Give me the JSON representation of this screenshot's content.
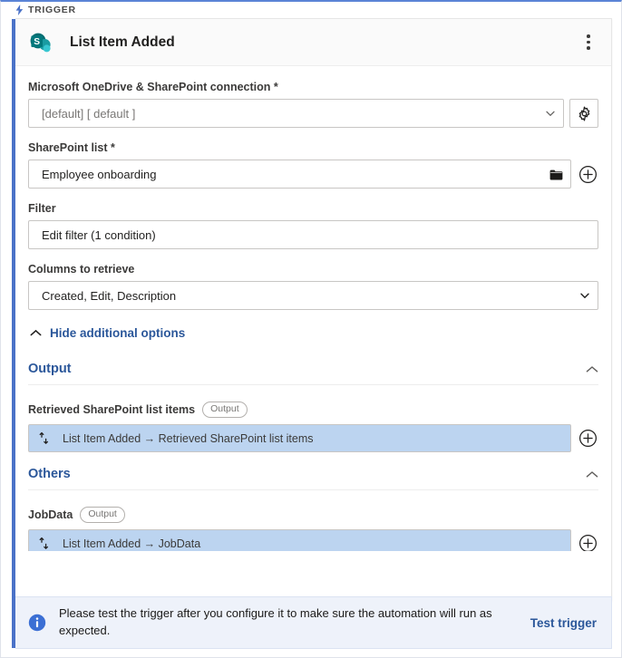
{
  "trigger_strip": {
    "label": "TRIGGER",
    "icon": "bolt-icon"
  },
  "card": {
    "title": "List Item Added",
    "app_icon": "sharepoint-icon",
    "menu_icon": "kebab-menu-icon"
  },
  "fields": {
    "connection": {
      "label": "Microsoft OneDrive & SharePoint connection *",
      "value": "[default] [ default ]",
      "dropdown_icon": "chevron-down-icon",
      "settings_icon": "gear-icon"
    },
    "sharepoint_list": {
      "label": "SharePoint list *",
      "value": "Employee onboarding",
      "browse_icon": "folder-icon",
      "add_icon": "plus-circle-icon"
    },
    "filter": {
      "label": "Filter",
      "value": "Edit filter (1 condition)"
    },
    "columns": {
      "label": "Columns to retrieve",
      "value": "Created, Edit, Description",
      "dropdown_icon": "chevron-down-icon"
    }
  },
  "additional_options": {
    "label": "Hide additional options",
    "icon": "chevron-up-icon"
  },
  "sections": [
    {
      "title": "Output",
      "collapse_icon": "chevron-up-icon",
      "rows": [
        {
          "label": "Retrieved SharePoint list items",
          "badge": "Output",
          "variable": "List Item Added → Retrieved SharePoint list items",
          "var_icon": "updown-arrows-icon",
          "add_icon": "plus-circle-icon"
        }
      ]
    },
    {
      "title": "Others",
      "collapse_icon": "chevron-up-icon",
      "rows": [
        {
          "label": "JobData",
          "badge": "Output",
          "variable": "List Item Added → JobData",
          "var_icon": "updown-arrows-icon",
          "add_icon": "plus-circle-icon"
        }
      ]
    }
  ],
  "footer": {
    "icon": "info-icon",
    "message": "Please test the trigger after you configure it to make sure the automation will run as expected.",
    "action_label": "Test trigger"
  },
  "colors": {
    "accent_blue": "#4a72c8",
    "link_blue": "#2b579a",
    "chip_blue": "#bcd4f0",
    "footer_bg": "#eef2fa",
    "sharepoint_teal": "#046c5f"
  }
}
